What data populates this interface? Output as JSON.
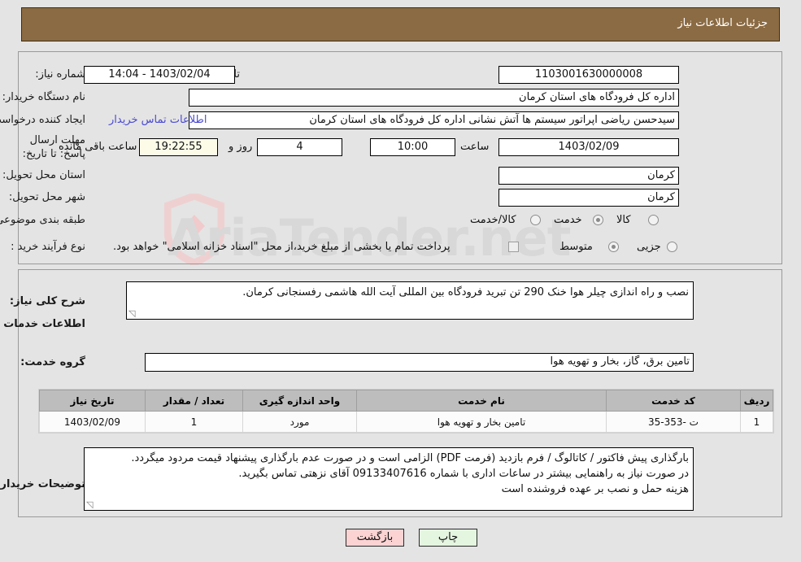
{
  "header": {
    "title": "جزئیات اطلاعات نیاز"
  },
  "fields": {
    "need_number_label": "شماره نیاز:",
    "need_number_value": "1103001630000008",
    "announce_label": "تاریخ و ساعت اعلان عمومی:",
    "announce_value": "1403/02/04 - 14:04",
    "buyer_org_label": "نام دستگاه خریدار:",
    "buyer_org_value": "اداره کل فرودگاه های استان کرمان",
    "creator_label": "ایجاد کننده درخواست:",
    "creator_value": "سیدحسن ریاضی اپراتور سیستم ها آتش نشانی اداره کل فرودگاه های استان کرمان",
    "contact_link": "اطلاعات تماس خریدار",
    "deadline_label": "مهلت ارسال پاسخ: تا تاریخ:",
    "deadline_date": "1403/02/09",
    "hour_label": "ساعت",
    "deadline_time": "10:00",
    "days_value": "4",
    "days_label": "روز و",
    "countdown_value": "19:22:55",
    "countdown_label": "ساعت باقی مانده",
    "province_label": "استان محل تحویل:",
    "province_value": "کرمان",
    "city_label": "شهر محل تحویل:",
    "city_value": "کرمان",
    "category_label": "طبقه بندی موضوعی:",
    "category_options": [
      "کالا",
      "خدمت",
      "کالا/خدمت"
    ],
    "category_selected": "خدمت",
    "process_label": "نوع فرآیند خرید :",
    "process_options": [
      "جزیی",
      "متوسط"
    ],
    "process_selected": "متوسط",
    "treasury_checkbox_label": "پرداخت تمام یا بخشی از مبلغ خرید،از محل \"اسناد خزانه اسلامی\" خواهد بود.",
    "treasury_checked": false
  },
  "description": {
    "label": "شرح کلی نیاز:",
    "value": "نصب و راه اندازی چیلر هوا خنک 290 تن تبرید فرودگاه بین المللی آیت الله هاشمی رفسنجانی کرمان."
  },
  "services_section": {
    "heading": "اطلاعات خدمات مورد نیاز",
    "group_label": "گروه خدمت:",
    "group_value": "تامین برق، گاز، بخار و تهویه هوا"
  },
  "table": {
    "columns": [
      "ردیف",
      "کد خدمت",
      "نام خدمت",
      "واحد اندازه گیری",
      "تعداد / مقدار",
      "تاریخ نیاز"
    ],
    "rows": [
      {
        "row": "1",
        "service_code": "ت -353-35",
        "service_name": "تامین بخار و تهویه هوا",
        "unit": "مورد",
        "quantity": "1",
        "need_date": "1403/02/09"
      }
    ]
  },
  "buyer_notes": {
    "label": "توضیحات خریدار:",
    "line1": "بارگذاری پیش فاکتور / کاتالوگ / فرم بازدید (فرمت PDF) الزامی است و در صورت عدم بارگذاری پیشنهاد قیمت مردود میگردد.",
    "line2": "در صورت نیاز به راهنمایی بیشتر در ساعات اداری با شماره 09133407616 آقای نزهتی  تماس بگیرید.",
    "line3": "هزینه حمل و نصب بر عهده فروشنده است"
  },
  "buttons": {
    "back": "بازگشت",
    "print": "چاپ"
  },
  "watermark": {
    "text": "AriaTender.net"
  },
  "colors": {
    "header_bg": "#8b6b43",
    "link": "#4a4ad6",
    "back_btn": "#fbd3d3",
    "print_btn": "#e4f5e0",
    "countdown_bg": "#fbfbe8"
  }
}
